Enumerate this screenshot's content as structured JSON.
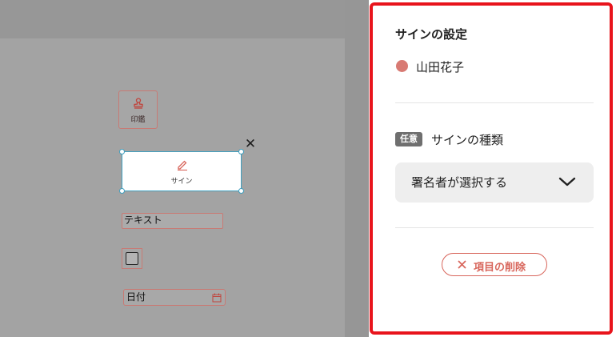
{
  "canvas": {
    "stamp_field": {
      "label": "印鑑",
      "icon": "stamp-icon"
    },
    "sign_field": {
      "label": "サイン",
      "icon": "pen-icon",
      "selected": true
    },
    "close_glyph": "✕",
    "text_field": {
      "label": "テキスト"
    },
    "checkbox_field": {
      "checked": false
    },
    "date_field": {
      "label": "日付",
      "icon": "calendar-icon"
    }
  },
  "panel": {
    "title": "サインの設定",
    "signer": {
      "name": "山田花子",
      "color": "#d87a73"
    },
    "optional_badge": "任意",
    "sign_type_label": "サインの種類",
    "sign_type_select": {
      "value": "署名者が選択する",
      "icon": "chevron-down-icon"
    },
    "delete_button": {
      "label": "項目の削除",
      "icon": "close-icon"
    }
  },
  "colors": {
    "panel_border": "#e8141c",
    "field_border": "#c87a74",
    "selection": "#3f9fbf",
    "delete": "#d8665c"
  }
}
